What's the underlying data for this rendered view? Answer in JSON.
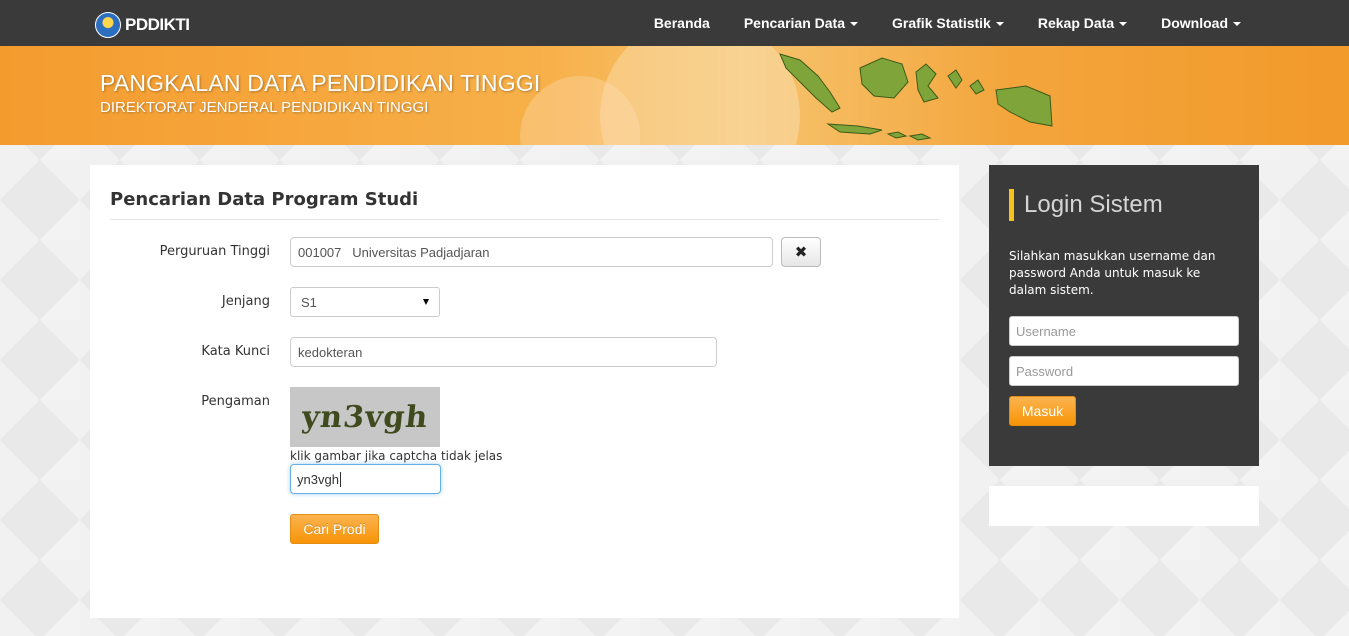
{
  "navbar": {
    "brand": "PDDIKTI",
    "items": [
      {
        "label": "Beranda",
        "dropdown": false
      },
      {
        "label": "Pencarian Data",
        "dropdown": true
      },
      {
        "label": "Grafik Statistik",
        "dropdown": true
      },
      {
        "label": "Rekap Data",
        "dropdown": true
      },
      {
        "label": "Download",
        "dropdown": true
      }
    ]
  },
  "banner": {
    "title": "PANGKALAN DATA PENDIDIKAN TINGGI",
    "subtitle": "DIREKTORAT JENDERAL PENDIDIKAN TINGGI"
  },
  "search_form": {
    "title": "Pencarian Data Program Studi",
    "perguruan_tinggi": {
      "label": "Perguruan Tinggi",
      "value": "001007   Universitas Padjadjaran"
    },
    "jenjang": {
      "label": "Jenjang",
      "value": "S1"
    },
    "kata_kunci": {
      "label": "Kata Kunci",
      "value": "kedokteran"
    },
    "pengaman": {
      "label": "Pengaman",
      "captcha_text": "yn3vgh",
      "hint": "klik gambar jika captcha tidak jelas",
      "value": "yn3vgh"
    },
    "submit_label": "Cari Prodi"
  },
  "login": {
    "title": "Login Sistem",
    "description": "Silahkan masukkan username dan password Anda untuk masuk ke dalam sistem.",
    "username_placeholder": "Username",
    "password_placeholder": "Password",
    "submit_label": "Masuk"
  },
  "colors": {
    "navbar": "#3a3a3a",
    "accent_orange": "#f89406",
    "login_accent": "#f7c21c"
  }
}
